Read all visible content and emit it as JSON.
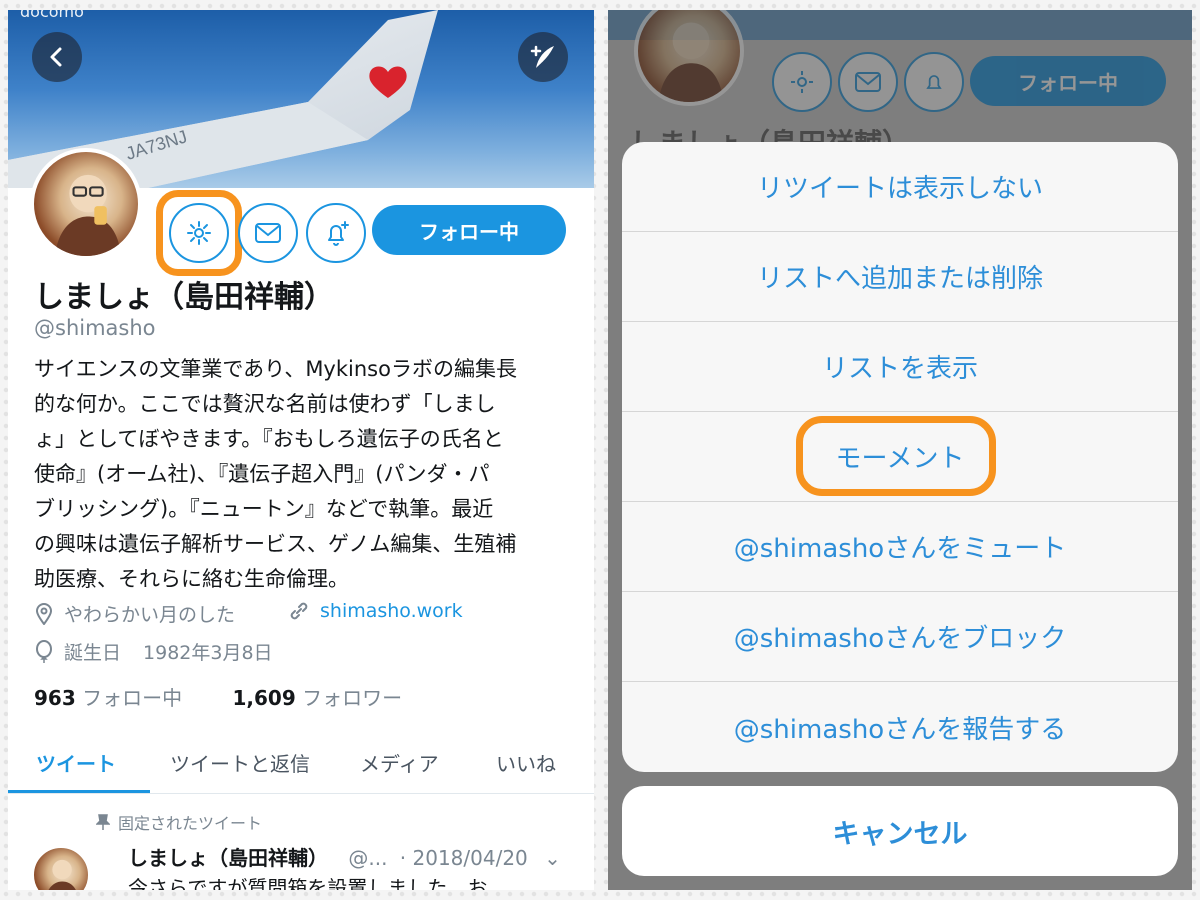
{
  "colors": {
    "accent": "#1b95e0",
    "highlight": "#f7931e",
    "text": "#14171a",
    "muted": "#7a8691"
  },
  "left": {
    "status_text": "docomo",
    "back_icon": "chevron-left-icon",
    "compose_icon": "compose-tweet-icon",
    "follow_button": "フォロー中",
    "profile": {
      "name": "しましょ（島田祥輔）",
      "handle": "@shimasho",
      "bio_lines": [
        "サイエンスの文筆業であり、Mykinsoラボの編集長",
        "的な何か。ここでは贅沢な名前は使わず「しまし",
        "ょ」としてぼやきます。『おもしろ遺伝子の氏名と",
        "使命』(オーム社)、『遺伝子超入門』(パンダ・パ",
        "ブリッシング)。『ニュートン』などで執筆。最近",
        "の興味は遺伝子解析サービス、ゲノム編集、生殖補",
        "助医療、それらに絡む生命倫理。"
      ],
      "location": "やわらかい月のした",
      "website": "shimasho.work",
      "birthday_label": "誕生日",
      "birthday": "1982年3月8日",
      "following_count": "963",
      "following_label": "フォロー中",
      "followers_count": "1,609",
      "followers_label": "フォロワー"
    },
    "tabs": [
      "ツイート",
      "ツイートと返信",
      "メディア",
      "いいね"
    ],
    "pinned": {
      "label": "固定されたツイート",
      "name": "しましょ（島田祥輔）",
      "handle": "@...",
      "date": "· 2018/04/20",
      "text": "今さらですが質問箱を設置しました。お"
    }
  },
  "right": {
    "follow_button": "フォロー中",
    "name_partial": "しましょ（島田祥輔）",
    "menu_items": [
      "リツイートは表示しない",
      "リストへ追加または削除",
      "リストを表示",
      "モーメント",
      "@shimashoさんをミュート",
      "@shimashoさんをブロック",
      "@shimashoさんを報告する"
    ],
    "cancel": "キャンセル"
  }
}
